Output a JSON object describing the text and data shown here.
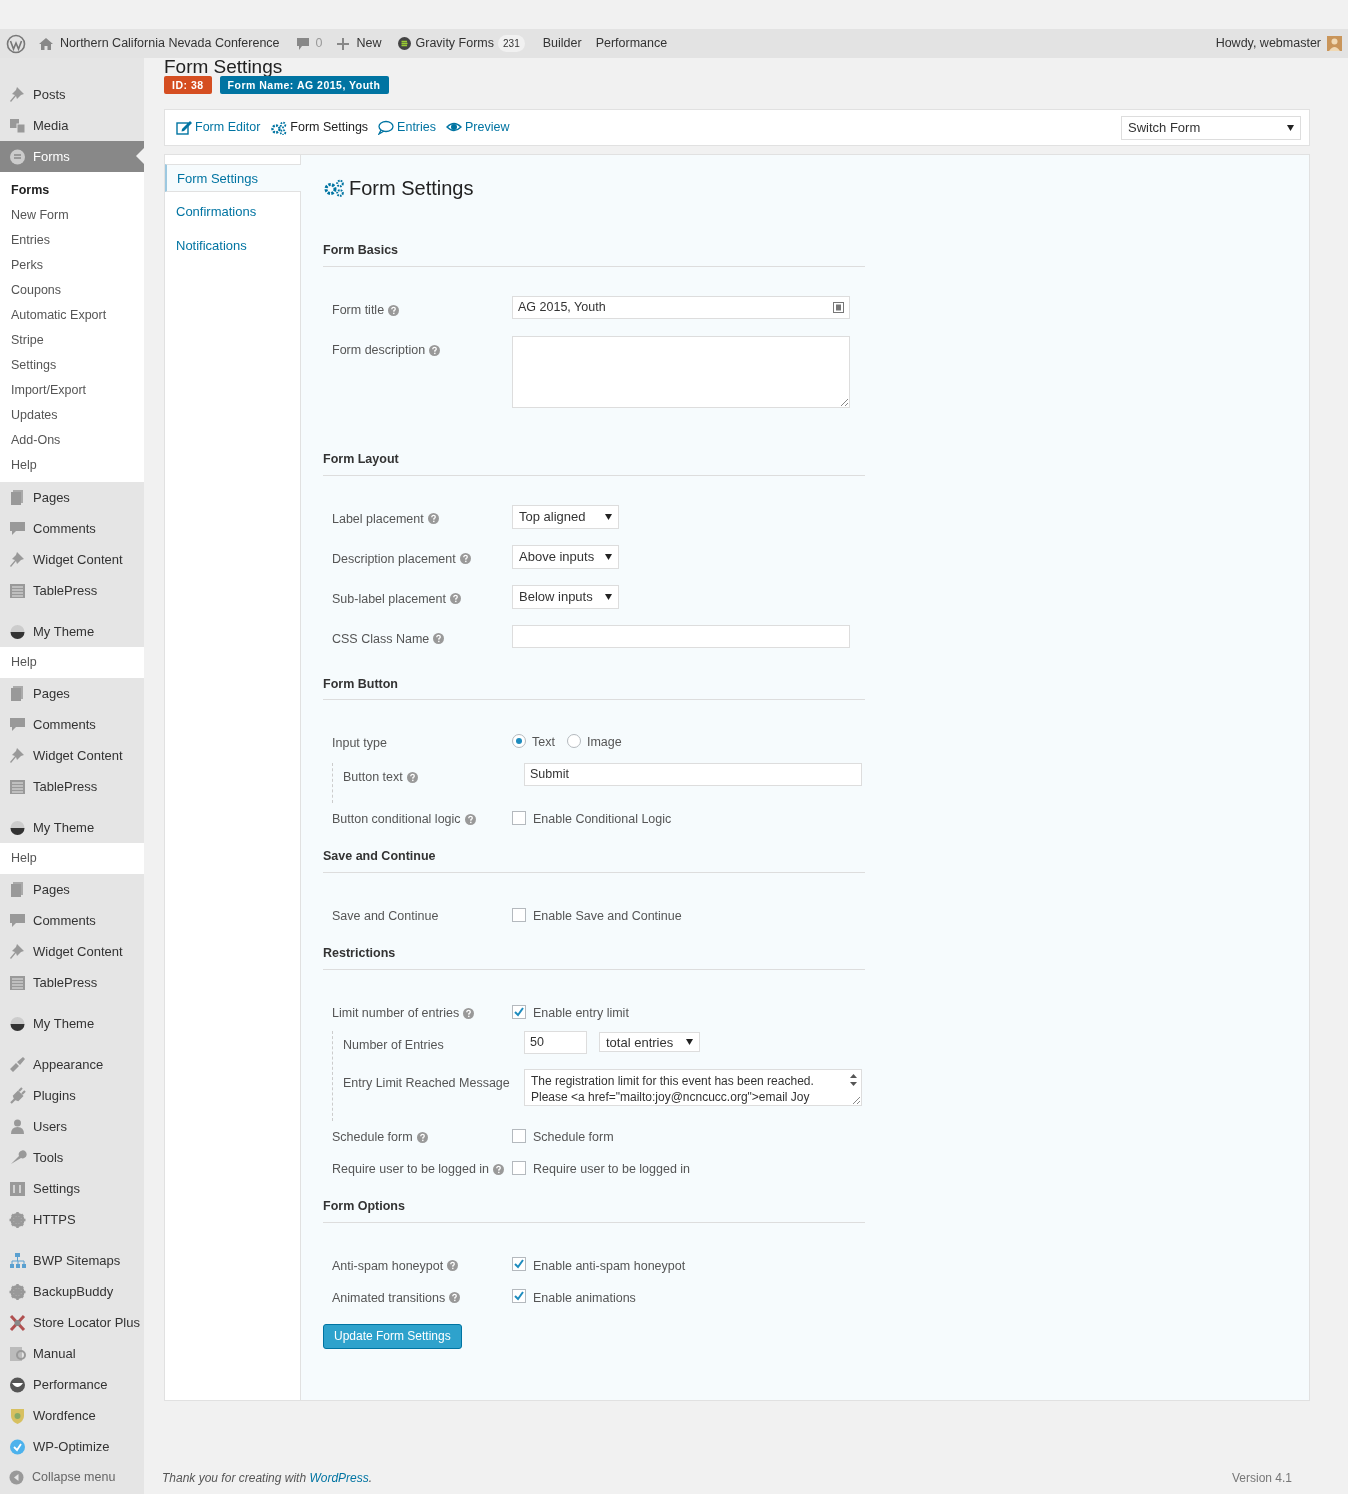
{
  "admin_bar": {
    "site": "Northern California Nevada Conference",
    "comments": "0",
    "new": "New",
    "plugin": "Gravity Forms",
    "plugin_count": "231",
    "links": [
      "Builder",
      "Performance"
    ],
    "greeting": "Howdy, webmaster"
  },
  "sidebar": {
    "items": [
      {
        "kind": "menu",
        "label": "Posts",
        "selected": false
      },
      {
        "kind": "menu",
        "label": "Media",
        "selected": false
      },
      {
        "kind": "menu",
        "label": "Forms",
        "selected": true,
        "submenu": [
          {
            "label": "Forms",
            "selected": true
          },
          {
            "label": "New Form",
            "selected": false
          },
          {
            "label": "Entries",
            "selected": false
          },
          {
            "label": "Perks",
            "selected": false
          },
          {
            "label": "Coupons",
            "selected": false
          },
          {
            "label": "Automatic Export",
            "selected": false
          },
          {
            "label": "Stripe",
            "selected": false
          },
          {
            "label": "Settings",
            "selected": false
          },
          {
            "label": "Import/Export",
            "selected": false
          },
          {
            "label": "Updates",
            "selected": false
          },
          {
            "label": "Add-Ons",
            "selected": false
          },
          {
            "label": "Help",
            "selected": false
          }
        ]
      },
      {
        "kind": "menu",
        "label": "Pages",
        "selected": false
      },
      {
        "kind": "menu",
        "label": "Comments",
        "selected": false
      },
      {
        "kind": "menu",
        "label": "Widget Content",
        "selected": false
      },
      {
        "kind": "menu",
        "label": "TablePress",
        "selected": false
      },
      {
        "kind": "separator"
      },
      {
        "kind": "menu",
        "label": "My Theme",
        "selected": false
      },
      {
        "kind": "subitem",
        "label": "Help"
      },
      {
        "kind": "menu",
        "label": "Pages",
        "selected": false
      },
      {
        "kind": "menu",
        "label": "Comments",
        "selected": false
      },
      {
        "kind": "menu",
        "label": "Widget Content",
        "selected": false
      },
      {
        "kind": "menu",
        "label": "TablePress",
        "selected": false
      },
      {
        "kind": "separator"
      },
      {
        "kind": "menu",
        "label": "My Theme",
        "selected": false
      },
      {
        "kind": "subitem",
        "label": "Help"
      },
      {
        "kind": "menu",
        "label": "Pages",
        "selected": false
      },
      {
        "kind": "menu",
        "label": "Comments",
        "selected": false
      },
      {
        "kind": "menu",
        "label": "Widget Content",
        "selected": false
      },
      {
        "kind": "menu",
        "label": "TablePress",
        "selected": false
      },
      {
        "kind": "separator"
      },
      {
        "kind": "menu",
        "label": "My Theme",
        "selected": false
      },
      {
        "kind": "separator"
      },
      {
        "kind": "menu",
        "label": "Appearance",
        "selected": false
      },
      {
        "kind": "menu",
        "label": "Plugins",
        "selected": false
      },
      {
        "kind": "menu",
        "label": "Users",
        "selected": false
      },
      {
        "kind": "menu",
        "label": "Tools",
        "selected": false
      },
      {
        "kind": "menu",
        "label": "Settings",
        "selected": false
      },
      {
        "kind": "menu",
        "label": "HTTPS",
        "selected": false
      },
      {
        "kind": "separator"
      },
      {
        "kind": "menu",
        "label": "BWP Sitemaps",
        "selected": false
      },
      {
        "kind": "menu",
        "label": "BackupBuddy",
        "selected": false
      },
      {
        "kind": "menu",
        "label": "Store Locator Plus",
        "selected": false
      },
      {
        "kind": "menu",
        "label": "Manual",
        "selected": false
      },
      {
        "kind": "menu",
        "label": "Performance",
        "selected": false
      },
      {
        "kind": "menu",
        "label": "Wordfence",
        "selected": false
      },
      {
        "kind": "menu",
        "label": "WP-Optimize",
        "selected": false
      },
      {
        "kind": "collapse",
        "label": "Collapse menu"
      }
    ]
  },
  "page_title": "Form Settings",
  "badges": [
    {
      "text": "ID: 38",
      "color": "#d54e21"
    },
    {
      "text": "Form Name: AG 2015, Youth",
      "color": "#0074a2"
    }
  ],
  "toolbar": {
    "items": [
      {
        "label": "Form Editor",
        "selected": false
      },
      {
        "label": "Form Settings",
        "selected": true
      },
      {
        "label": "Entries",
        "selected": false
      },
      {
        "label": "Preview",
        "selected": false
      }
    ],
    "switch_form": "Switch Form"
  },
  "tabs": [
    {
      "label": "Form Settings",
      "selected": true
    },
    {
      "label": "Confirmations",
      "selected": false
    },
    {
      "label": "Notifications",
      "selected": false
    }
  ],
  "heading": "Form Settings",
  "sections": [
    {
      "title": "Form Basics",
      "rows": [
        {
          "kind": "text",
          "label": "Form title",
          "help": true,
          "value": "AG 2015, Youth",
          "merge_icon": true
        },
        {
          "kind": "textarea",
          "label": "Form description",
          "help": true
        }
      ]
    },
    {
      "title": "Form Layout",
      "rows": [
        {
          "kind": "select",
          "label": "Label placement",
          "help": true,
          "value": "Top aligned"
        },
        {
          "kind": "select",
          "label": "Description placement",
          "help": true,
          "value": "Above inputs"
        },
        {
          "kind": "select",
          "label": "Sub-label placement",
          "help": true,
          "value": "Below inputs"
        },
        {
          "kind": "text",
          "label": "CSS Class Name",
          "help": true
        }
      ]
    },
    {
      "title": "Form Button",
      "rows": [
        {
          "kind": "radio",
          "label": "Input type",
          "help": false,
          "options": [
            {
              "label": "Text",
              "selected": true
            },
            {
              "label": "Image",
              "selected": false
            }
          ],
          "children": [
            {
              "kind": "text",
              "label": "Button text",
              "help": true,
              "value": "Submit"
            }
          ]
        },
        {
          "kind": "checkbox",
          "label": "Button conditional logic",
          "help": true,
          "option": "Enable Conditional Logic",
          "checked": false
        }
      ]
    },
    {
      "title": "Save and Continue",
      "rows": [
        {
          "kind": "checkbox",
          "label": "Save and Continue",
          "help": false,
          "option": "Enable Save and Continue",
          "checked": false
        }
      ]
    },
    {
      "title": "Restrictions",
      "rows": [
        {
          "kind": "checkbox",
          "label": "Limit number of entries",
          "help": true,
          "option": "Enable entry limit",
          "checked": true,
          "children": [
            {
              "kind": "number",
              "label": "Number of Entries",
              "help": false,
              "value": "50",
              "unit": "total entries"
            },
            {
              "kind": "message",
              "label": "Entry Limit Reached Message",
              "help": false,
              "value": "The registration limit for this event has been reached.\nPlease <a href=\"mailto:joy@ncncucc.org\">email Joy"
            }
          ]
        },
        {
          "kind": "checkbox",
          "label": "Schedule form",
          "help": true,
          "option": "Schedule form",
          "checked": false
        },
        {
          "kind": "checkbox",
          "label": "Require user to be logged in",
          "help": true,
          "option": "Require user to be logged in",
          "checked": false
        }
      ]
    },
    {
      "title": "Form Options",
      "rows": [
        {
          "kind": "checkbox",
          "label": "Anti-spam honeypot",
          "help": true,
          "option": "Enable anti-spam honeypot",
          "checked": true
        },
        {
          "kind": "checkbox",
          "label": "Animated transitions",
          "help": true,
          "option": "Enable animations",
          "checked": true
        }
      ]
    }
  ],
  "submit": "Update Form Settings",
  "footer": {
    "text": "Thank you for creating with ",
    "link": "WordPress",
    "after": ".",
    "version": "Version 4.1"
  }
}
